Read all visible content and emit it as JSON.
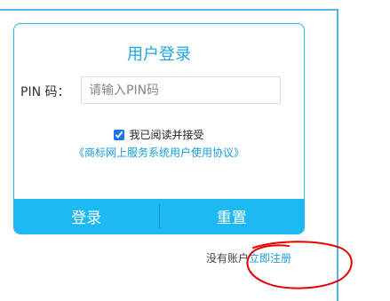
{
  "login": {
    "title": "用户登录",
    "pin_label": "PIN 码：",
    "pin_placeholder": "请输入PIN码",
    "pin_value": "",
    "agree_checked": true,
    "agree_text": "我已阅读并接受",
    "agreement_link": "《商标网上服务系统用户使用协议》",
    "login_button": "登录",
    "reset_button": "重置"
  },
  "register": {
    "prompt": "没有账户",
    "link": "立即注册"
  },
  "colors": {
    "accent": "#1db9f2",
    "link": "#1a9fe0",
    "annotation": "#e60000"
  }
}
